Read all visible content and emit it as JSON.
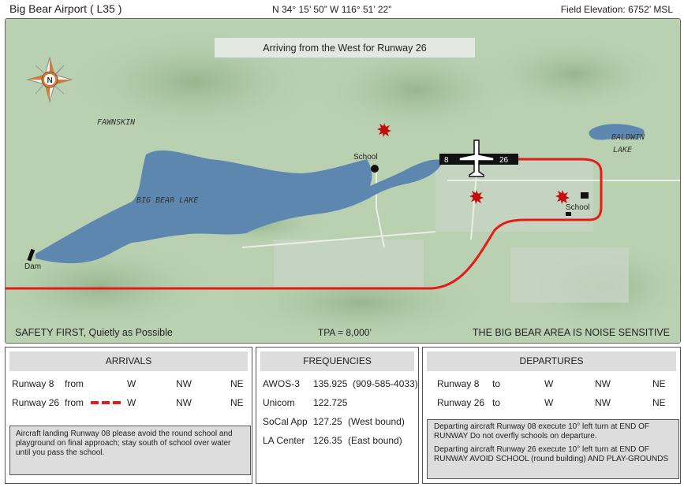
{
  "header": {
    "title": "Big Bear Airport  ( L35 )",
    "coords": "N 34° 15’ 50”   W 116° 51’ 22”",
    "elevation": "Field Elevation: 6752’ MSL"
  },
  "map": {
    "banner": "Arriving from the West for Runway 26",
    "compass_letter": "N",
    "places": {
      "fawnskin": "FAWNSKIN",
      "big_bear_lake": "BIG BEAR LAKE",
      "baldwin_1": "BALDWIN",
      "baldwin_2": "LAKE",
      "school_north": "School",
      "school_east": "School",
      "dam": "Dam"
    },
    "runway": {
      "left": "8",
      "right": "26"
    },
    "footer_left": "SAFETY FIRST, Quietly as Possible",
    "footer_center": "TPA = 8,000’",
    "footer_right": "THE BIG BEAR AREA IS NOISE SENSITIVE",
    "colors": {
      "water": "#5e87b0",
      "terrain": "#b9d1b1",
      "route": "#e41b17",
      "hazard": "#c40e0e"
    }
  },
  "arrivals": {
    "title": "ARRIVALS",
    "rows": [
      {
        "runway": "Runway 8",
        "from": "from",
        "w": "W",
        "nw": "NW",
        "ne": "NE"
      },
      {
        "runway": "Runway 26",
        "from": "from",
        "w": "W",
        "nw": "NW",
        "ne": "NE"
      }
    ],
    "note": "Aircraft landing Runway 08 please avoid the round school and playground on final approach; stay south of school over water until you pass the school."
  },
  "frequencies": {
    "title": "FREQUENCIES",
    "rows": [
      {
        "name": "AWOS-3",
        "freq": "135.925",
        "extra": "(909-585-4033)"
      },
      {
        "name": "Unicom",
        "freq": "122.725",
        "extra": ""
      },
      {
        "name": "SoCal App",
        "freq": "127.25",
        "extra": "(West bound)"
      },
      {
        "name": "LA Center",
        "freq": "126.35",
        "extra": "(East bound)"
      }
    ]
  },
  "departures": {
    "title": "DEPARTURES",
    "rows": [
      {
        "runway": "Runway 8",
        "to": "to",
        "w": "W",
        "nw": "NW",
        "ne": "NE"
      },
      {
        "runway": "Runway 26",
        "to": "to",
        "w": "W",
        "nw": "NW",
        "ne": "NE"
      }
    ],
    "note1": "Departing aircraft Runway 08 execute 10° left turn at END OF RUNWAY Do not overfly schools on departure.",
    "note2": "Departing aircraft Runway 26 execute 10° left turn at END OF RUNWAY AVOID SCHOOL (round building) AND PLAY-GROUNDS"
  }
}
